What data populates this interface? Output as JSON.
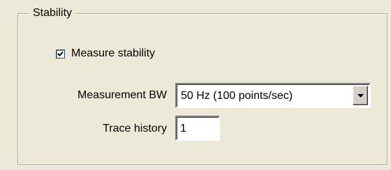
{
  "group": {
    "title": "Stability"
  },
  "measure_stability": {
    "label": "Measure stability",
    "checked": true
  },
  "measurement_bw": {
    "label": "Measurement BW",
    "value": "50 Hz (100 points/sec)"
  },
  "trace_history": {
    "label": "Trace history",
    "value": "1"
  },
  "icons": {
    "checkmark": "check-icon",
    "dropdown": "triangle-down-icon"
  },
  "colors": {
    "background": "#ece9d8",
    "group_border": "#aca899",
    "checkbox_border": "#1c5180",
    "field_background": "#ffffff"
  }
}
